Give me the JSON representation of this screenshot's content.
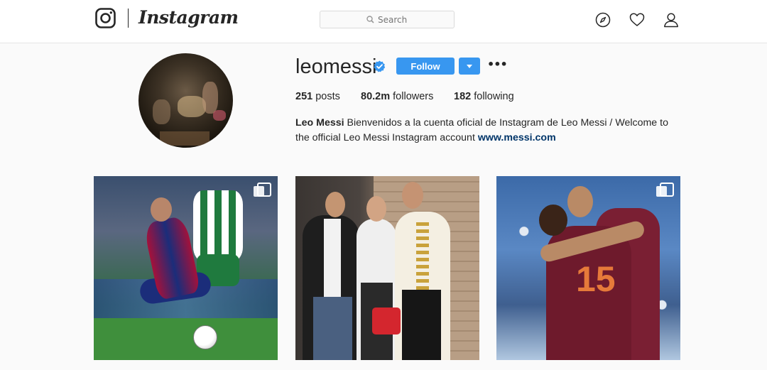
{
  "nav": {
    "brand": "Instagram",
    "search_placeholder": "Search"
  },
  "profile": {
    "username": "leomessi",
    "verified": true,
    "follow_label": "Follow",
    "more_label": "•••",
    "stats": {
      "posts_count": "251",
      "posts_label": "posts",
      "followers_count": "80.2m",
      "followers_label": "followers",
      "following_count": "182",
      "following_label": "following"
    },
    "bio": {
      "name": "Leo Messi",
      "text": " Bienvenidos a la cuenta oficial de Instagram de Leo Messi / Welcome to the official Leo Messi Instagram account ",
      "link": "www.messi.com"
    }
  },
  "posts": [
    {
      "type": "multi-photo"
    },
    {
      "type": "photo"
    },
    {
      "type": "multi-photo"
    }
  ],
  "colors": {
    "accent": "#3897f0",
    "link": "#003569",
    "background": "#fafafa"
  },
  "icons": [
    "instagram-logo-icon",
    "search-icon",
    "compass-icon",
    "heart-icon",
    "user-icon",
    "verified-icon",
    "dropdown-caret-icon",
    "multi-photo-icon"
  ]
}
